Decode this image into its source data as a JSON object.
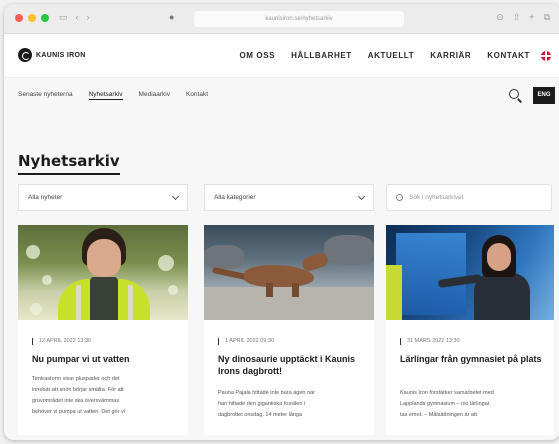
{
  "browser": {
    "url": "kaunisiron.se/nyhetsarkiv"
  },
  "site": {
    "logo_text": "KAUNIS IRON",
    "nav": [
      "OM OSS",
      "HÅLLBARHET",
      "AKTUELLT",
      "KARRIÄR",
      "KONTAKT"
    ],
    "lang_button": "ENG"
  },
  "subnav": [
    "Senaste nyheterna",
    "Nyhetsarkiv",
    "Mediaarkiv",
    "Kontakt"
  ],
  "page": {
    "title": "Nyhetsarkiv"
  },
  "filters": {
    "news": "Alla nyheter",
    "category": "Alla kategorier",
    "search_placeholder": "Sök i nyhetsarkivet"
  },
  "articles": [
    {
      "date": "12 APRIL 2022 13:30",
      "title": "Nu pumpar vi ut vatten",
      "excerpt": [
        "Tentrastorm visar pluspader och det",
        "innebär att snön börjar smälta. För att",
        "gruvområdet inte ska översvämmas",
        "behöver vi pumpa ut vatten. Det gör vi"
      ]
    },
    {
      "date": "1 APRIL 2022 09:30",
      "title": "Ny dinosaurie upptäckt i Kaunis Irons dagbrott!",
      "excerpt": [
        "Pauna Pajala hittade inte bara ägen när",
        "han hittade den gigantiska fossilen i",
        "dagbrottet onsdag. 14 meter långa"
      ]
    },
    {
      "date": "31 MARS 2022 13:30",
      "title": "Lärlingar från gymnasiet på plats",
      "excerpt": [
        "Kaunis Iron förstärker samarbetet med",
        "Lapplands gymnasium – nio lärlingar",
        "tas emot. – Målsättningen är att"
      ]
    }
  ],
  "colors": {
    "accent_dark": "#1b1b1b",
    "flag_red": "#c8102e"
  }
}
